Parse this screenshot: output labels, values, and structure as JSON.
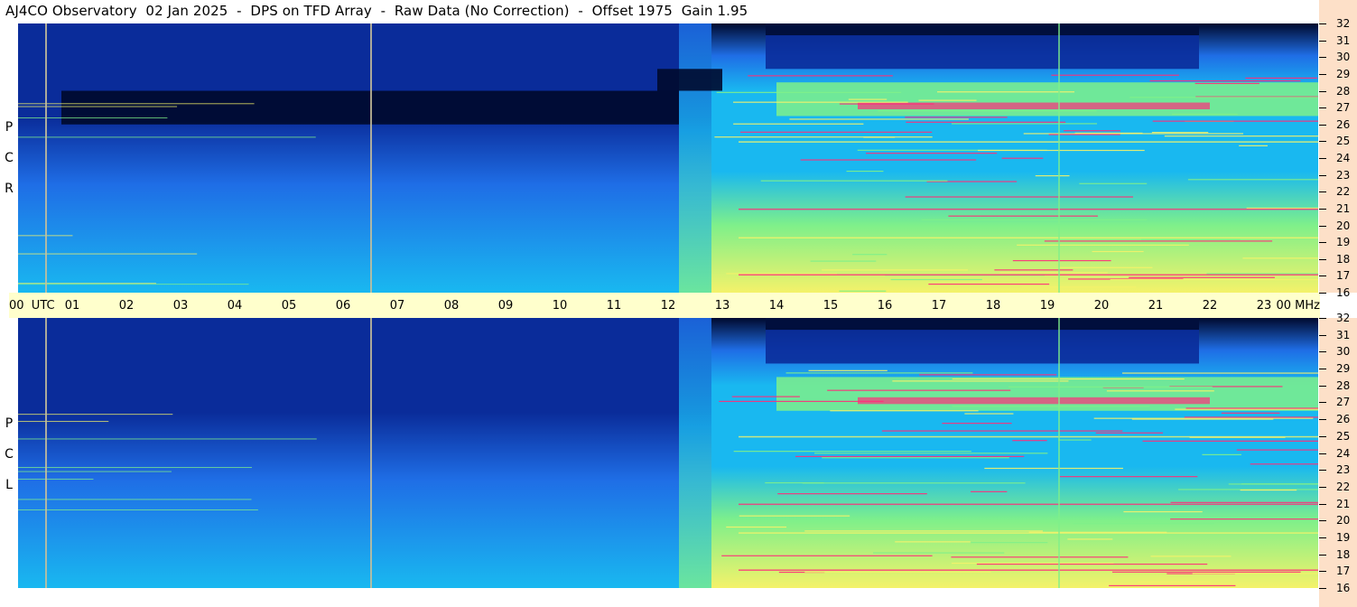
{
  "title": "AJ4CO Observatory  02 Jan 2025  -  DPS on TFD Array  -  Raw Data (No Correction)  -  Offset 1975  Gain 1.95",
  "colors": {
    "dark": "#000a2e",
    "deep_blue": "#0a2c9a",
    "blue": "#1f6ee6",
    "cyan": "#19b8f0",
    "green": "#7ff08a",
    "yellow": "#f4f26a",
    "red": "#ff2d7a",
    "time_axis_bg": "#ffffcc",
    "freq_axis_bg": "#fde0c8"
  },
  "chart_data": [
    {
      "type": "heatmap",
      "panel": "RCP",
      "side_label": [
        "P",
        "C",
        "R"
      ],
      "x_unit": "UTC",
      "x_range_hours": [
        0,
        24
      ],
      "y_unit": "MHz",
      "y_range": [
        16,
        32
      ],
      "y_ticks": [
        "32",
        "31",
        "30",
        "29",
        "28",
        "27",
        "26",
        "25",
        "24",
        "23",
        "22",
        "21",
        "20",
        "19",
        "18",
        "17",
        "16"
      ],
      "vertical_markers_hours": [
        0.5,
        6.5,
        19.2
      ],
      "activity": {
        "quiet_dark_band_mhz": [
          26.0,
          28.0
        ],
        "quiet_dark_band_hours": [
          0.8,
          12.2
        ],
        "daytime_high_hours": [
          12.8,
          24.0
        ],
        "storm_band_mhz": [
          26.5,
          28.5
        ],
        "storm_band_hours": [
          14.0,
          24.0
        ],
        "notes": "Daytime HF noise brightens the array from ~13 UTC to 24 UTC; strongest near 27 MHz and 17-19 MHz."
      }
    },
    {
      "type": "heatmap",
      "panel": "LCP",
      "side_label": [
        "P",
        "C",
        "L"
      ],
      "x_unit": "UTC",
      "x_range_hours": [
        0,
        24
      ],
      "y_unit": "MHz",
      "y_range": [
        16,
        32
      ],
      "y_ticks": [
        "32",
        "31",
        "30",
        "29",
        "28",
        "27",
        "26",
        "25",
        "24",
        "23",
        "22",
        "21",
        "20",
        "19",
        "18",
        "17",
        "16"
      ],
      "vertical_markers_hours": [
        0.5,
        6.5,
        19.2
      ],
      "activity": {
        "daytime_high_hours": [
          12.8,
          24.0
        ],
        "storm_band_mhz": [
          26.5,
          28.5
        ],
        "storm_band_hours": [
          14.0,
          24.0
        ]
      }
    }
  ],
  "time_axis": {
    "labels": [
      "00  UTC",
      "01",
      "02",
      "03",
      "04",
      "05",
      "06",
      "07",
      "08",
      "09",
      "10",
      "11",
      "12",
      "13",
      "14",
      "15",
      "16",
      "17",
      "18",
      "19",
      "20",
      "21",
      "22",
      "23",
      "00 MHz"
    ]
  }
}
